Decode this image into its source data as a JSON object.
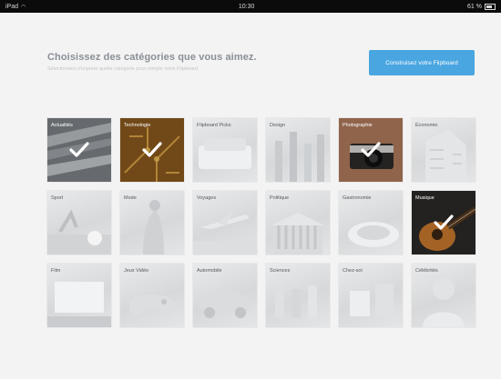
{
  "status_bar": {
    "device": "iPad",
    "time": "10:30",
    "battery": "61 %"
  },
  "header": {
    "title": "Choisissez des catégories que vous aimez.",
    "subtitle": "Sélectionnez n'importe quelle catégorie pour remplir votre Flipboard",
    "build_button": "Construisez votre Flipboard"
  },
  "categories": [
    {
      "label": "Actualités",
      "selected": true,
      "icon": "news-photo"
    },
    {
      "label": "Technologie",
      "selected": true,
      "icon": "circuit-board-photo"
    },
    {
      "label": "Flipboard Picks",
      "selected": false,
      "icon": "couch-photo"
    },
    {
      "label": "Design",
      "selected": false,
      "icon": "architecture-photo"
    },
    {
      "label": "Photographie",
      "selected": true,
      "icon": "camera-photo"
    },
    {
      "label": "Économie",
      "selected": false,
      "icon": "building-photo"
    },
    {
      "label": "Sport",
      "selected": false,
      "icon": "soccer-ball-photo"
    },
    {
      "label": "Mode",
      "selected": false,
      "icon": "fashion-photo"
    },
    {
      "label": "Voyages",
      "selected": false,
      "icon": "airplane-photo"
    },
    {
      "label": "Politique",
      "selected": false,
      "icon": "capitol-photo"
    },
    {
      "label": "Gastronomie",
      "selected": false,
      "icon": "food-plate-photo"
    },
    {
      "label": "Musique",
      "selected": true,
      "icon": "guitar-photo"
    },
    {
      "label": "Film",
      "selected": false,
      "icon": "film-screen-photo"
    },
    {
      "label": "Jeux Vidéo",
      "selected": false,
      "icon": "game-controller-photo"
    },
    {
      "label": "Automobile",
      "selected": false,
      "icon": "car-photo"
    },
    {
      "label": "Sciences",
      "selected": false,
      "icon": "lab-photo"
    },
    {
      "label": "Chez-soi",
      "selected": false,
      "icon": "chair-photo"
    },
    {
      "label": "Célébrités",
      "selected": false,
      "icon": "celebrity-photo"
    }
  ],
  "colors": {
    "accent": "#4aa6e1",
    "title": "#8a8f96",
    "subtitle": "#c2c5c9",
    "tile_gray": "#d6d8da",
    "background": "#f3f3f3"
  }
}
